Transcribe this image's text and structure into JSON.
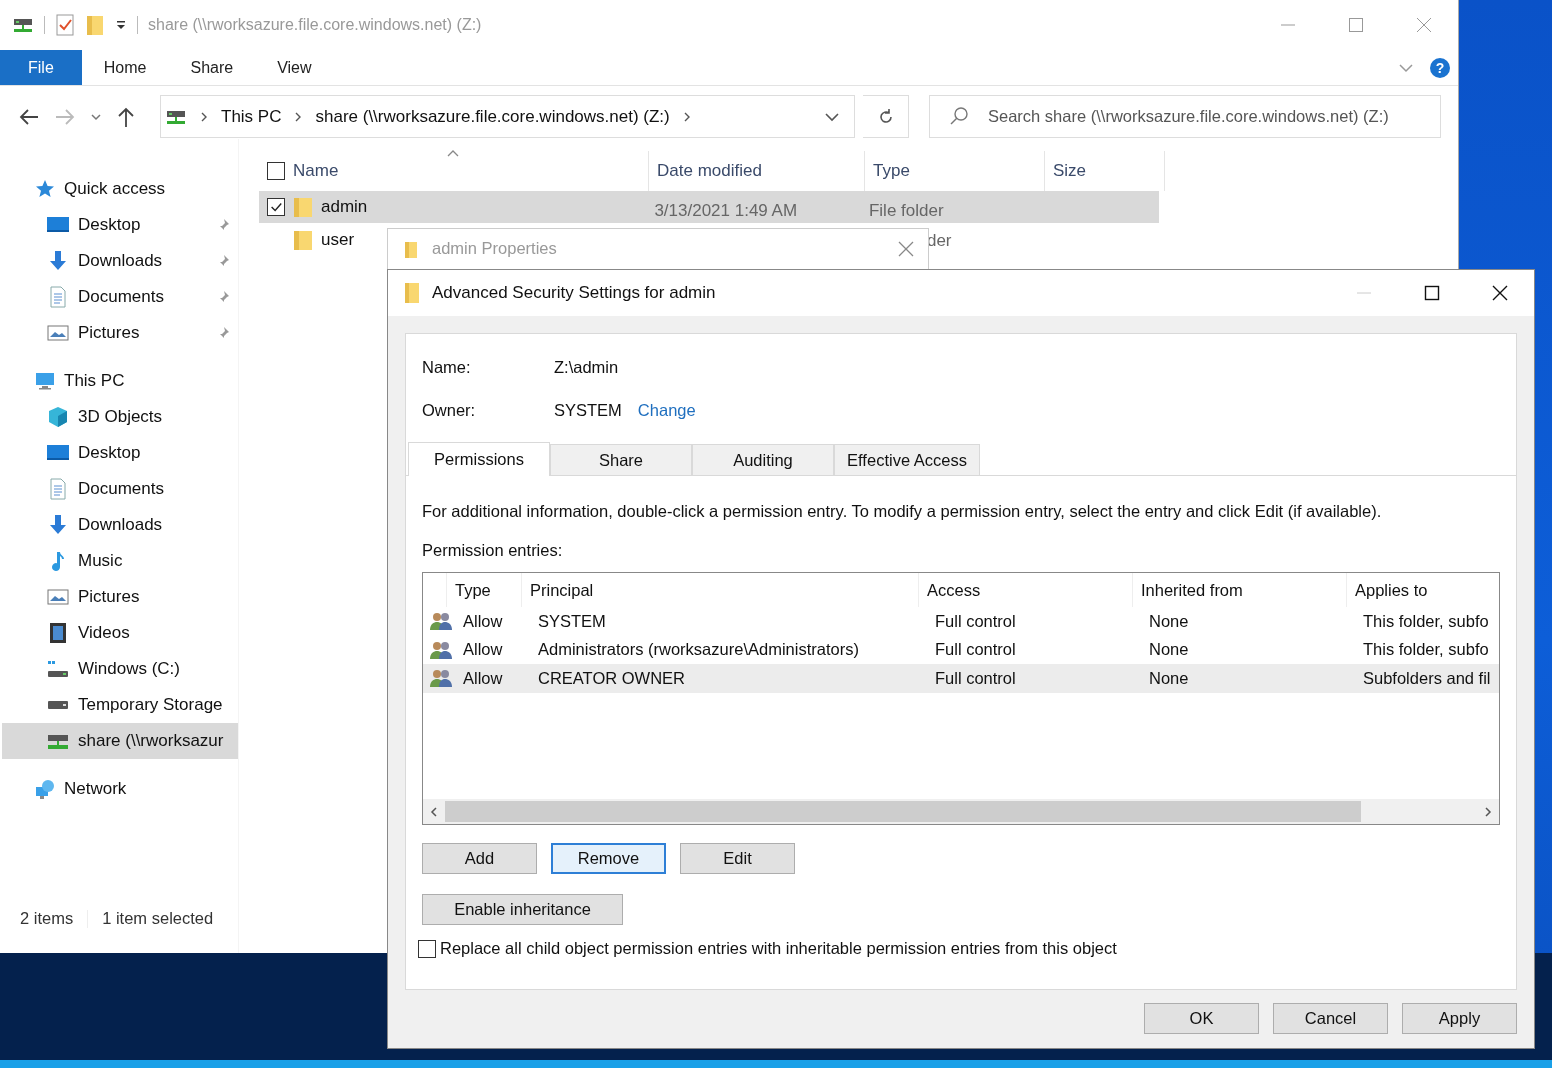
{
  "explorer": {
    "title": "share (\\\\rworksazure.file.core.windows.net) (Z:)",
    "ribbon_tabs": [
      {
        "label": "File",
        "selected": true
      },
      {
        "label": "Home",
        "selected": false
      },
      {
        "label": "Share",
        "selected": false
      },
      {
        "label": "View",
        "selected": false
      }
    ],
    "help_button": "?",
    "breadcrumb": [
      "This PC",
      "share (\\\\rworksazure.file.core.windows.net) (Z:)"
    ],
    "search": {
      "placeholder": "Search share (\\\\rworksazure.file.core.windows.net) (Z:)"
    },
    "sidebar": [
      {
        "label": "Quick access",
        "kind": "star",
        "selected": false,
        "children": [
          {
            "label": "Desktop",
            "kind": "desktop",
            "pinned": true,
            "selected": false
          },
          {
            "label": "Downloads",
            "kind": "download",
            "pinned": true,
            "selected": false
          },
          {
            "label": "Documents",
            "kind": "document",
            "pinned": true,
            "selected": false
          },
          {
            "label": "Pictures",
            "kind": "pictures",
            "pinned": true,
            "selected": false
          }
        ]
      },
      {
        "label": "This PC",
        "kind": "pc",
        "selected": false,
        "children": [
          {
            "label": "3D Objects",
            "kind": "cube",
            "pinned": false,
            "selected": false
          },
          {
            "label": "Desktop",
            "kind": "desktop",
            "pinned": false,
            "selected": false
          },
          {
            "label": "Documents",
            "kind": "document",
            "pinned": false,
            "selected": false
          },
          {
            "label": "Downloads",
            "kind": "download",
            "pinned": false,
            "selected": false
          },
          {
            "label": "Music",
            "kind": "music",
            "pinned": false,
            "selected": false
          },
          {
            "label": "Pictures",
            "kind": "pictures",
            "pinned": false,
            "selected": false
          },
          {
            "label": "Videos",
            "kind": "video",
            "pinned": false,
            "selected": false
          },
          {
            "label": "Windows (C:)",
            "kind": "windrive",
            "pinned": false,
            "selected": false
          },
          {
            "label": "Temporary Storage",
            "kind": "drive",
            "pinned": false,
            "selected": false
          },
          {
            "label": "share (\\\\rworksazur",
            "kind": "netdrive",
            "pinned": false,
            "selected": true
          }
        ]
      },
      {
        "label": "Network",
        "kind": "network",
        "selected": false
      }
    ],
    "columns": [
      "Name",
      "Date modified",
      "Type",
      "Size"
    ],
    "all_checked": false,
    "files": [
      {
        "name": "admin",
        "date": "3/13/2021 1:49 AM",
        "type": "File folder",
        "selected": true,
        "checked": true
      },
      {
        "name": "user",
        "type": "der",
        "selected": false,
        "checked": false
      }
    ],
    "status": [
      "2 items",
      "1 item selected"
    ]
  },
  "properties_dialog": {
    "title": "admin Properties"
  },
  "security_dialog": {
    "title": "Advanced Security Settings for admin",
    "name_label": "Name:",
    "name_value": "Z:\\admin",
    "owner_label": "Owner:",
    "owner_value": "SYSTEM",
    "change_link": "Change",
    "tabs": [
      {
        "label": "Permissions",
        "selected": true
      },
      {
        "label": "Share",
        "selected": false
      },
      {
        "label": "Auditing",
        "selected": false
      },
      {
        "label": "Effective Access",
        "selected": false
      }
    ],
    "info": "For additional information, double-click a permission entry. To modify a permission entry, select the entry and click Edit (if available).",
    "entries_label": "Permission entries:",
    "columns": [
      "Type",
      "Principal",
      "Access",
      "Inherited from",
      "Applies to"
    ],
    "rows": [
      {
        "type": "Allow",
        "principal": "SYSTEM",
        "access": "Full control",
        "inherited": "None",
        "applies": "This folder, subfo",
        "selected": false
      },
      {
        "type": "Allow",
        "principal": "Administrators (rworksazure\\Administrators)",
        "access": "Full control",
        "inherited": "None",
        "applies": "This folder, subfo",
        "selected": false
      },
      {
        "type": "Allow",
        "principal": "CREATOR OWNER",
        "access": "Full control",
        "inherited": "None",
        "applies": "Subfolders and fil",
        "selected": true
      }
    ],
    "buttons": [
      {
        "label": "Add",
        "focused": false
      },
      {
        "label": "Remove",
        "focused": true
      },
      {
        "label": "Edit",
        "focused": false
      }
    ],
    "inheritance_button": "Enable inheritance",
    "replace_option": {
      "label": "Replace all child object permission entries with inheritable permission entries from this object",
      "checked": false
    },
    "footer_buttons": [
      "OK",
      "Cancel",
      "Apply"
    ]
  }
}
